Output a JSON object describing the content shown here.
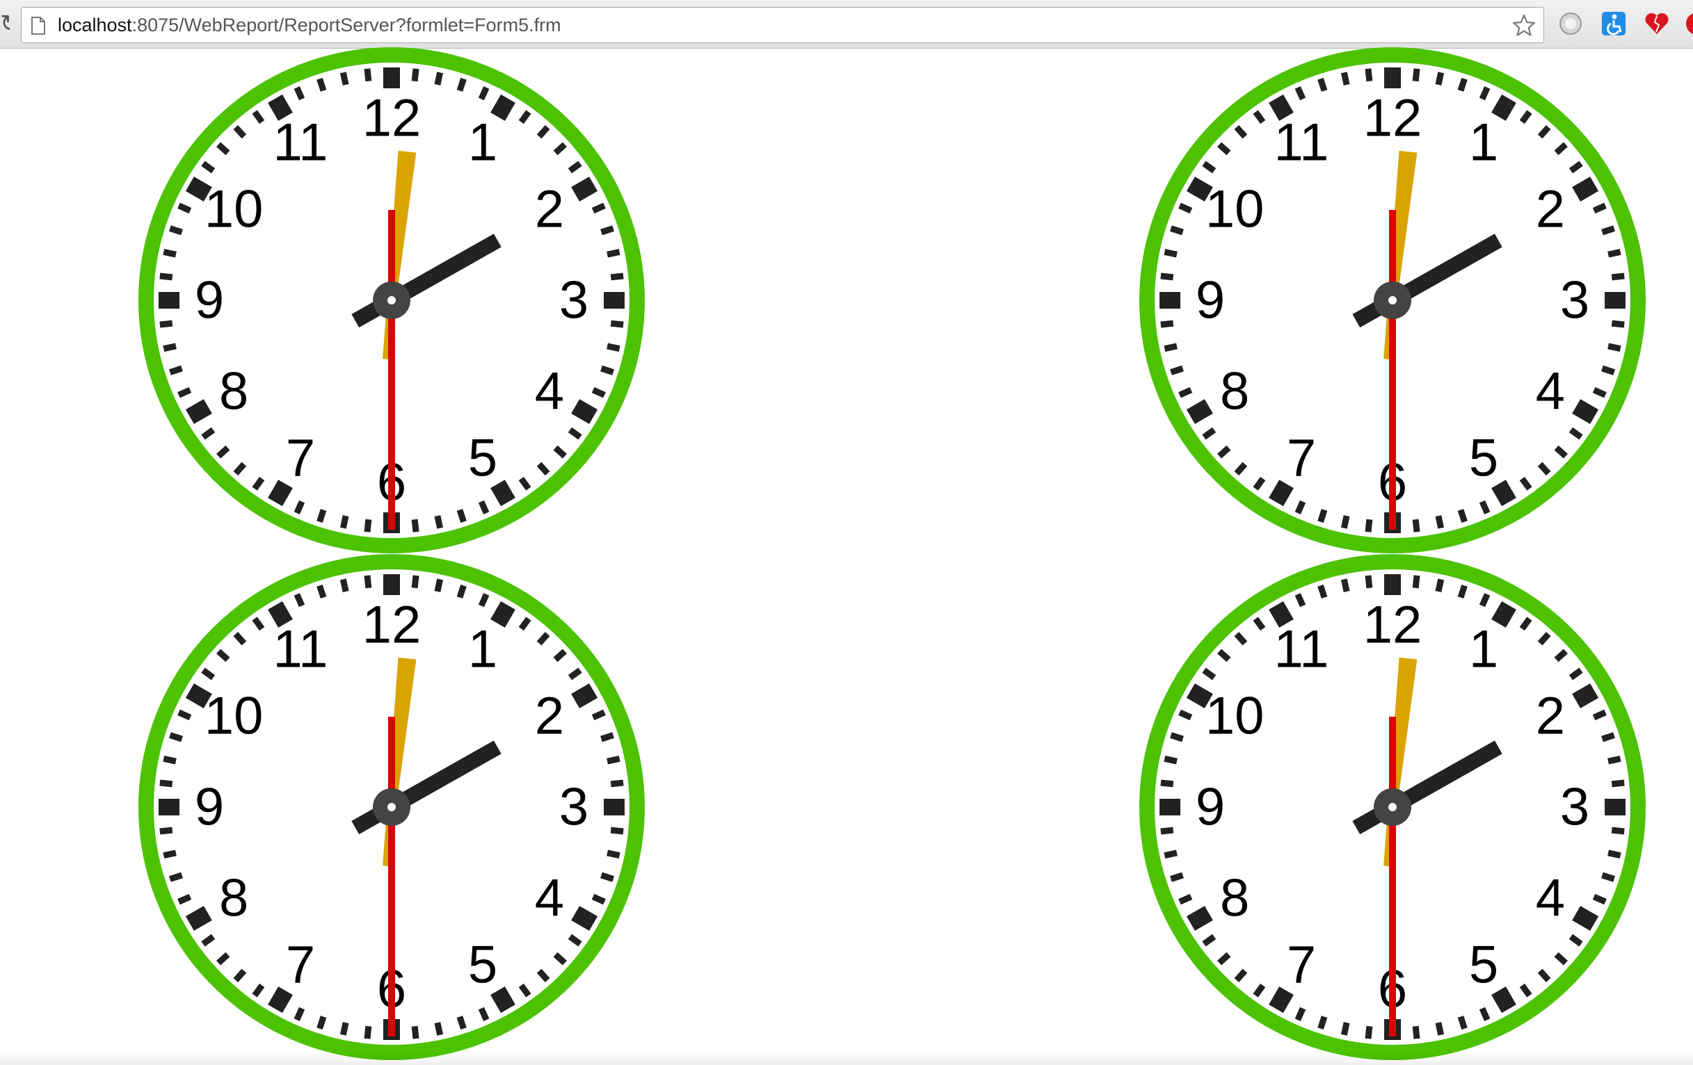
{
  "browser": {
    "url_host": "localhost",
    "url_rest": ":8075/WebReport/ReportServer?formlet=Form5.frm",
    "icons": [
      "page-icon",
      "star-icon",
      "globe-extension-icon",
      "accessibility-extension-icon",
      "heart-extension-icon",
      "red-extension-icon"
    ]
  },
  "clocks": [
    {
      "id": "clock-top-left",
      "numerals": [
        "12",
        "1",
        "2",
        "3",
        "4",
        "5",
        "6",
        "7",
        "8",
        "9",
        "10",
        "11"
      ]
    },
    {
      "id": "clock-top-right",
      "numerals": [
        "12",
        "1",
        "2",
        "3",
        "4",
        "5",
        "6",
        "7",
        "8",
        "9",
        "10",
        "11"
      ]
    },
    {
      "id": "clock-bottom-left",
      "numerals": [
        "12",
        "1",
        "2",
        "3",
        "4",
        "5",
        "6",
        "7",
        "8",
        "9",
        "10",
        "11"
      ]
    },
    {
      "id": "clock-bottom-right",
      "numerals": [
        "12",
        "1",
        "2",
        "3",
        "4",
        "5",
        "6",
        "7",
        "8",
        "9",
        "10",
        "11"
      ]
    }
  ],
  "clock_style": {
    "ring_color": "#4cc200",
    "face_color": "#ffffff",
    "tick_color": "#222222",
    "hour_hand_color": "#222222",
    "minute_hand_color": "#d9a400",
    "second_hand_color": "#dd0000",
    "hub_color": "#444444"
  },
  "time": {
    "hour": 2,
    "minute": 1,
    "second": 30
  }
}
